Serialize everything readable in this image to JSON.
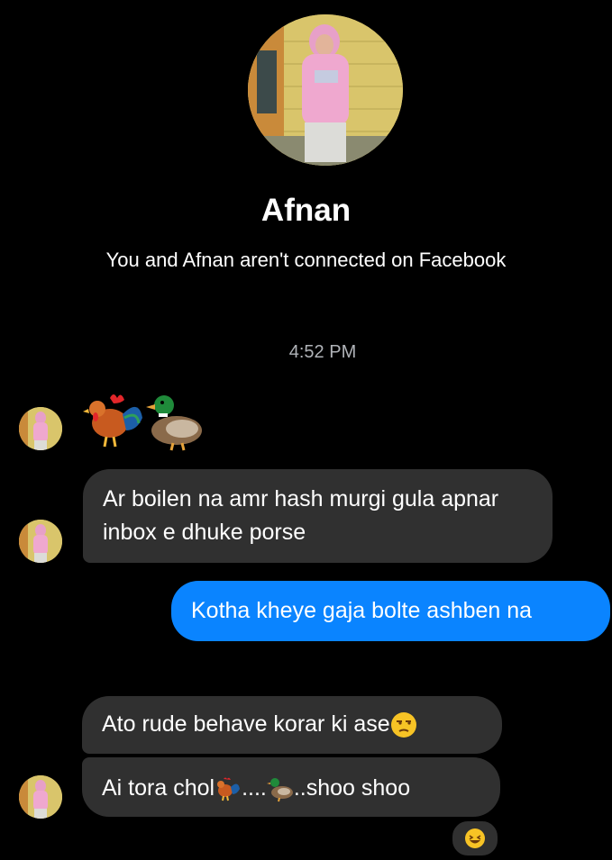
{
  "contact": {
    "name": "Afnan",
    "subtitle": "You and Afnan aren't connected on Facebook"
  },
  "conversation": {
    "timestamp": "4:52 PM",
    "messages": [
      {
        "sender": "Afnan",
        "direction": "incoming",
        "type": "emoji",
        "emojis": [
          "rooster-icon",
          "duck-icon"
        ]
      },
      {
        "sender": "Afnan",
        "direction": "incoming",
        "text": "Ar boilen na amr hash murgi gula apnar inbox e dhuke porse"
      },
      {
        "sender": "me",
        "direction": "outgoing",
        "text": "Kotha kheye gaja bolte ashben na"
      },
      {
        "sender": "Afnan",
        "direction": "incoming",
        "text_parts": [
          "Ato rude behave korar ki ase"
        ],
        "trailing_emoji": "unamused-face-icon"
      },
      {
        "sender": "Afnan",
        "direction": "incoming",
        "text_parts": [
          "Ai tora chol",
          "....",
          "..shoo shoo"
        ],
        "inline_emojis": [
          "rooster-icon",
          "duck-icon"
        ]
      }
    ],
    "reaction": "laughing-face-icon"
  },
  "colors": {
    "background": "#000000",
    "incoming_bubble": "#303030",
    "outgoing_bubble": "#0a84ff",
    "text": "#ffffff",
    "muted_text": "#b0b3b8"
  }
}
